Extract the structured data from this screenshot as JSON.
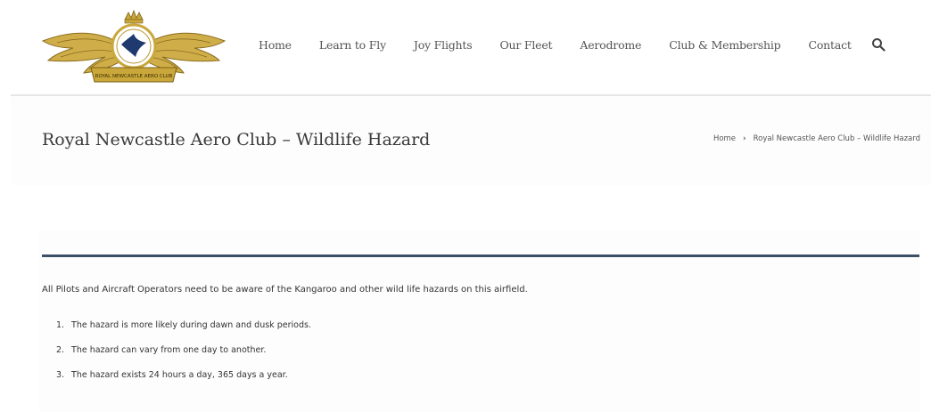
{
  "header": {
    "logo_text": "ROYAL NEWCASTLE AERO CLUB",
    "nav": [
      "Home",
      "Learn to Fly",
      "Joy Flights",
      "Our Fleet",
      "Aerodrome",
      "Club & Membership",
      "Contact"
    ],
    "search_icon": "search-icon"
  },
  "title_bar": {
    "title": "Royal Newcastle Aero Club – Wildlife Hazard",
    "breadcrumb": {
      "home": "Home",
      "separator": "›",
      "current": "Royal Newcastle Aero Club – Wildlife Hazard"
    }
  },
  "content": {
    "intro": "All Pilots and Aircraft Operators need to be aware of the Kangaroo and other wild life hazards on this airfield.",
    "items": [
      {
        "num": "1.",
        "text": "The hazard is more likely during dawn and dusk periods."
      },
      {
        "num": "2.",
        "text": "The hazard can vary from one day to another."
      },
      {
        "num": "3.",
        "text": "The hazard exists 24 hours a day, 365 days a year."
      }
    ]
  },
  "colors": {
    "content_rule": "#3d4f68",
    "logo_gold": "#c9a73b",
    "logo_navy": "#1e3a6e"
  }
}
